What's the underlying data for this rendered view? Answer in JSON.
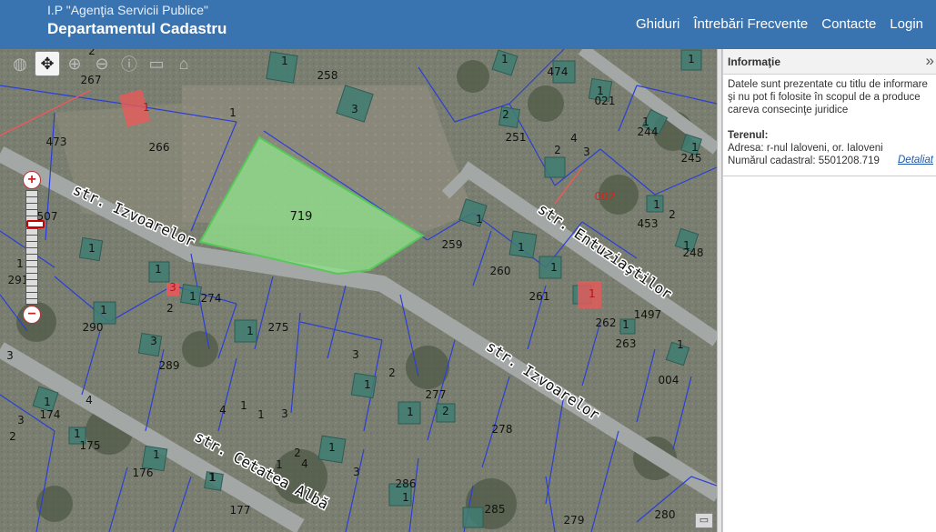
{
  "header": {
    "organization": "I.P \"Agenţia Servicii Publice\"",
    "department": "Departamentul Cadastru",
    "nav": [
      "Ghiduri",
      "Întrebări Frecvente",
      "Contacte",
      "Login"
    ]
  },
  "info": {
    "title": "Informaţie",
    "collapse_icon": "»",
    "disclaimer": "Datele sunt prezentate cu titlu de informare şi nu pot fi folosite în scopul de a produce careva consecinţe juridice",
    "land_title": "Terenul:",
    "address": "Adresa: r-nul Ialoveni, or. Ialoveni",
    "cadastral": "Numărul cadastral: 5501208.719",
    "details_link": "Detaliat"
  },
  "map": {
    "toolbar": [
      "globe-icon",
      "pan-icon",
      "zoom-in-icon",
      "zoom-out-icon",
      "info-icon",
      "measure-icon",
      "building-icon"
    ],
    "zoom_in": "+",
    "zoom_out": "−",
    "zoom_level_fraction": 0.27,
    "selected_parcel": "719",
    "streets": [
      "str. Izvoarelor",
      "str. Izvoarelor",
      "str. Entuziaştilor",
      "str. Cetatea Albă"
    ],
    "parcel_labels": [
      "267",
      "258",
      "474",
      "021",
      "473",
      "266",
      "244",
      "251",
      "245",
      "002",
      "507",
      "453",
      "248",
      "259",
      "260",
      "291",
      "274",
      "261",
      "262",
      "1497",
      "290",
      "275",
      "263",
      "289",
      "004",
      "277",
      "174",
      "278",
      "175",
      "176",
      "286",
      "177",
      "285",
      "279",
      "280"
    ],
    "building_labels": [
      "1",
      "2",
      "3",
      "4"
    ],
    "colors": {
      "selected_fill": "#8fe08a",
      "parcel_line": "#2b3fd6",
      "building": "#3f7d72",
      "highlight": "#e85a5a"
    }
  }
}
